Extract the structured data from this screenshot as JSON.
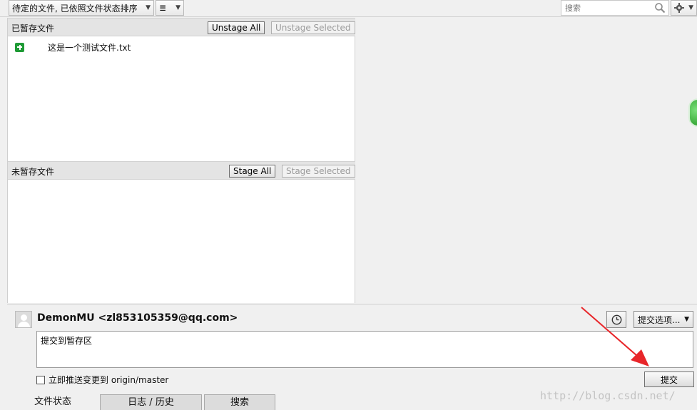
{
  "toolbar": {
    "sort_dropdown": "待定的文件, 已依照文件状态排序",
    "search_placeholder": "搜索"
  },
  "staged": {
    "title": "已暂存文件",
    "unstage_all": "Unstage All",
    "unstage_selected": "Unstage Selected",
    "files": [
      {
        "name": "这是一个测试文件.txt",
        "status": "added"
      }
    ]
  },
  "unstaged": {
    "title": "未暂存文件",
    "stage_all": "Stage All",
    "stage_selected": "Stage Selected"
  },
  "commit": {
    "author": "DemonMU <zl853105359@qq.com>",
    "options_label": "提交选项...",
    "message": "提交到暂存区",
    "push_label": "立即推送变更到 origin/master",
    "commit_button": "提交"
  },
  "tabs": {
    "status": "文件状态",
    "log": "日志 / 历史",
    "search": "搜索"
  },
  "watermark": "http://blog.csdn.net/",
  "colors": {
    "added_icon": "#1e9a35",
    "arrow": "#e8262a"
  }
}
